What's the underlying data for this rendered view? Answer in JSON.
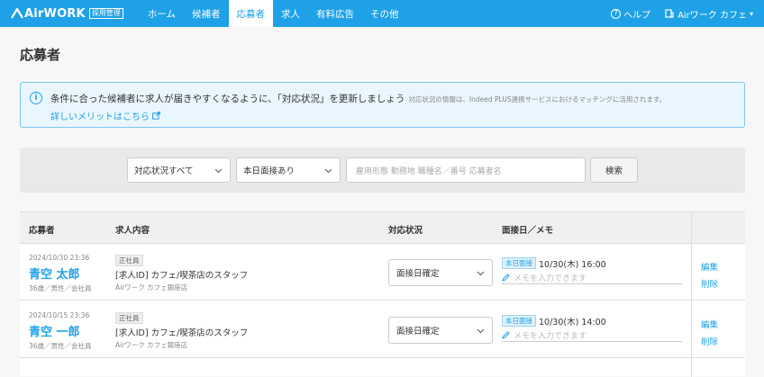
{
  "header": {
    "logo_text": "AirWORK",
    "logo_badge": "採用管理",
    "nav": [
      "ホーム",
      "候補者",
      "応募者",
      "求人",
      "有料広告",
      "その他"
    ],
    "active_nav": 2,
    "help_label": "ヘルプ",
    "account_label": "Airワーク カフェ",
    "brand_color": "#1ea1e6"
  },
  "page": {
    "title": "応募者"
  },
  "info": {
    "message": "条件に合った候補者に求人が届きやすくなるように、「対応状況」を更新しましょう",
    "note": "対応状況の情報は、Indeed PLUS連携サービスにおけるマッチングに活用されます。",
    "link": "詳しいメリットはこちら"
  },
  "filter": {
    "status_select": "対応状況すべて",
    "interview_select": "本日面接あり",
    "search_placeholder": "雇用形態 勤務地 職種名／番号 応募者名",
    "search_button": "検索"
  },
  "table": {
    "headers": {
      "applicant": "応募者",
      "job": "求人内容",
      "status": "対応状況",
      "interview": "面接日／メモ"
    },
    "rows": [
      {
        "date": "2024/10/30 23:36",
        "name": "青空 太郎",
        "profile": "36歳／男性／会社員",
        "employment": "正社員",
        "job": "[求人ID] カフェ/喫茶店のスタッフ",
        "store": "Airワーク カフェ銀座店",
        "status": "面接日確定",
        "interview_tag": "本日面接",
        "interview_time": "10/30(木) 16:00",
        "memo_placeholder": "メモを入力できます",
        "edit": "編集",
        "delete": "削除"
      },
      {
        "date": "2024/10/15 23:36",
        "name": "青空 一郎",
        "profile": "36歳／男性／会社員",
        "employment": "正社員",
        "job": "[求人ID] カフェ/喫茶店のスタッフ",
        "store": "Airワーク カフェ銀座店",
        "status": "面接日確定",
        "interview_tag": "本日面接",
        "interview_time": "10/30(木) 14:00",
        "memo_placeholder": "メモを入力できます",
        "edit": "編集",
        "delete": "削除"
      }
    ]
  }
}
